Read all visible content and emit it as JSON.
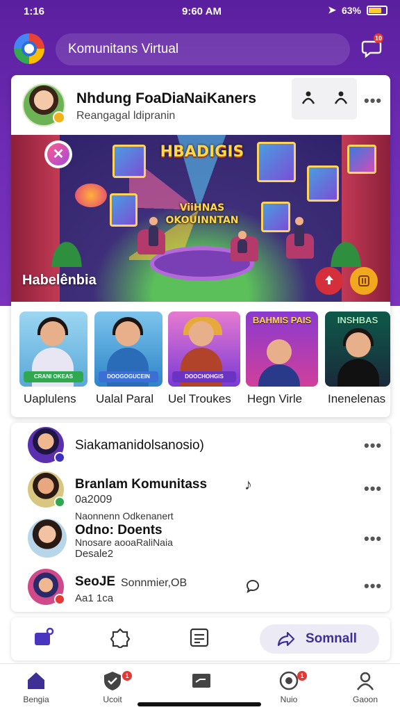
{
  "status_bar": {
    "time_left": "1:16",
    "time_center": "9:60 AM",
    "battery": "63%"
  },
  "app_bar": {
    "search_text": "Komunitans Virtual",
    "message_badge": "10"
  },
  "profile": {
    "name": "Nhdung FoaDiaNaiKaners",
    "subtitle": "Reangagal ldipranin"
  },
  "banner": {
    "title_line1": "HBADIGIS",
    "title_line2": "ViiHNAS OKOUINNTAN",
    "label": "Habelênbia"
  },
  "thumbnails": [
    {
      "label": "Uaplulens",
      "tag": "CRANI OKEAS"
    },
    {
      "label": "Ualal Paral",
      "tag": "DOOGOGUCEIN"
    },
    {
      "label": "Uel Troukes",
      "tag": "DOOCHOHGIS"
    },
    {
      "label": "Hegn Virle",
      "tag": "BAHMIS PAIS"
    },
    {
      "label": "Inenelenas",
      "tag": "INSHBAS"
    }
  ],
  "community_list": [
    {
      "title": "Siakamanidolsanosio)",
      "sub1": "",
      "sub2": ""
    },
    {
      "title": "Branlam Komunitass",
      "sub1": "0a2009",
      "sub2": "Naonnenn Odkenanert"
    },
    {
      "title": "Odno: Doents",
      "sub1": "Nnosare aooaRaliNaia",
      "sub2": "Desale2"
    },
    {
      "title": "SeoJE",
      "sub1": "Sonnmier,OB",
      "sub2": "Aa1 1ca"
    }
  ],
  "action_bar": {
    "share_label": "Somnall"
  },
  "bottom_nav": [
    {
      "label": "Bengia"
    },
    {
      "label": "Ucoit",
      "badge": "1"
    },
    {
      "label": ""
    },
    {
      "label": "Nuio",
      "badge": "1"
    },
    {
      "label": "Gaoon"
    }
  ],
  "colors": {
    "brand": "#6d2bb3",
    "accent": "#3d2f94",
    "badge": "#e53935"
  }
}
